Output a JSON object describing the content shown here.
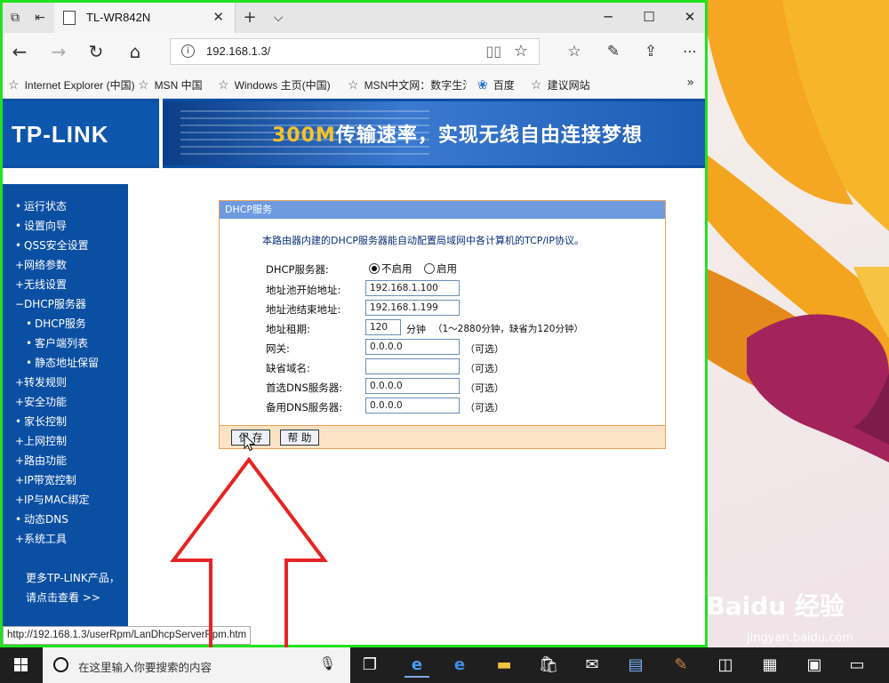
{
  "browser": {
    "tab_title": "TL-WR842N",
    "url": "192.168.1.3/",
    "status_url": "http://192.168.1.3/userRpm/LanDhcpServerRpm.htm"
  },
  "favorites": [
    {
      "label": "Internet Explorer (中国)",
      "icon": "star-icon"
    },
    {
      "label": "MSN 中国",
      "icon": "star-icon"
    },
    {
      "label": "Windows 主页(中国)",
      "icon": "star-icon"
    },
    {
      "label": "MSN中文网：数字生活",
      "icon": "star-icon"
    },
    {
      "label": "百度",
      "icon": "paw-icon"
    },
    {
      "label": "建议网站",
      "icon": "star-icon"
    }
  ],
  "router": {
    "logo": "TP-LINK",
    "slogan_hl": "300M",
    "slogan_rest": "传输速率，实现无线自由连接梦想",
    "menu": [
      {
        "label": "运行状态",
        "bullet": "•",
        "sub": false
      },
      {
        "label": "设置向导",
        "bullet": "•",
        "sub": false
      },
      {
        "label": "QSS安全设置",
        "bullet": "•",
        "sub": false
      },
      {
        "label": "网络参数",
        "bullet": "+",
        "sub": false
      },
      {
        "label": "无线设置",
        "bullet": "+",
        "sub": false
      },
      {
        "label": "DHCP服务器",
        "bullet": "−",
        "sub": false
      },
      {
        "label": "DHCP服务",
        "bullet": "•",
        "sub": true
      },
      {
        "label": "客户端列表",
        "bullet": "•",
        "sub": true
      },
      {
        "label": "静态地址保留",
        "bullet": "•",
        "sub": true
      },
      {
        "label": "转发规则",
        "bullet": "+",
        "sub": false
      },
      {
        "label": "安全功能",
        "bullet": "+",
        "sub": false
      },
      {
        "label": "家长控制",
        "bullet": "•",
        "sub": false
      },
      {
        "label": "上网控制",
        "bullet": "+",
        "sub": false
      },
      {
        "label": "路由功能",
        "bullet": "+",
        "sub": false
      },
      {
        "label": "IP带宽控制",
        "bullet": "+",
        "sub": false
      },
      {
        "label": "IP与MAC绑定",
        "bullet": "+",
        "sub": false
      },
      {
        "label": "动态DNS",
        "bullet": "•",
        "sub": false
      },
      {
        "label": "系统工具",
        "bullet": "+",
        "sub": false
      }
    ],
    "more_line1": "更多TP-LINK产品，",
    "more_line2": "请点击查看 >>"
  },
  "dhcp": {
    "header": "DHCP服务",
    "description": "本路由器内建的DHCP服务器能自动配置局域网中各计算机的TCP/IP协议。",
    "server_label": "DHCP服务器:",
    "opt_disable": "不启用",
    "opt_enable": "启用",
    "selected": "不启用",
    "start_label": "地址池开始地址:",
    "start_value": "192.168.1.100",
    "end_label": "地址池结束地址:",
    "end_value": "192.168.1.199",
    "lease_label": "地址租期:",
    "lease_value": "120",
    "lease_unit": "分钟",
    "lease_hint": "（1～2880分钟，缺省为120分钟）",
    "gateway_label": "网关:",
    "gateway_value": "0.0.0.0",
    "domain_label": "缺省域名:",
    "domain_value": "",
    "dns1_label": "首选DNS服务器:",
    "dns1_value": "0.0.0.0",
    "dns2_label": "备用DNS服务器:",
    "dns2_value": "0.0.0.0",
    "optional": "（可选）",
    "save": "保 存",
    "help": "帮 助"
  },
  "taskbar": {
    "search_placeholder": "在这里输入你要搜索的内容"
  },
  "watermark": {
    "main": "Baidu 经验",
    "sub": "jingyan.baidu.com"
  }
}
